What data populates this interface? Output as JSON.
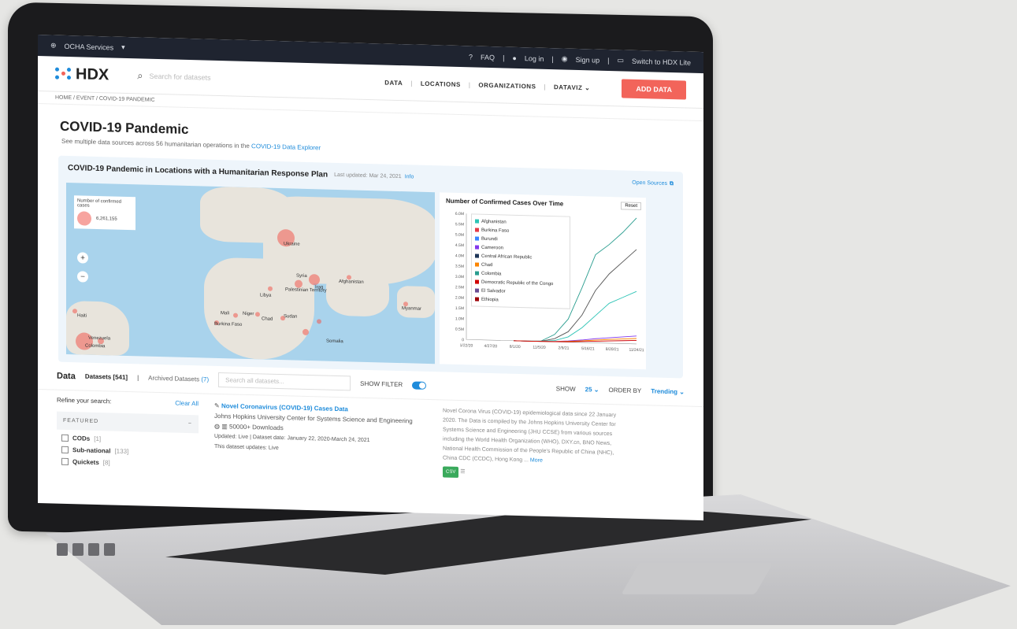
{
  "topbar": {
    "ocha": "OCHA Services",
    "faq": "FAQ",
    "login": "Log in",
    "signup": "Sign up",
    "switch": "Switch to HDX Lite"
  },
  "header": {
    "logo": "HDX",
    "search_placeholder": "Search for datasets",
    "nav": [
      "DATA",
      "LOCATIONS",
      "ORGANIZATIONS",
      "DATAVIZ"
    ],
    "add_data": "ADD DATA"
  },
  "breadcrumb": "HOME / EVENT / COVID-19 PANDEMIC",
  "page": {
    "title": "COVID-19 Pandemic",
    "subtitle": "See multiple data sources across 56 humanitarian operations in the",
    "subtitle_link": "COVID-19 Data Explorer"
  },
  "panel": {
    "title": "COVID-19 Pandemic in Locations with a Humanitarian Response Plan",
    "updated": "Last updated: Mar 24, 2021",
    "info": "Info",
    "source": "Open Sources",
    "map_legend_title": "Number of confirmed cases",
    "map_legend_value": "6,261,155",
    "map_labels": [
      "Ukraine",
      "Afghanistan",
      "Libya",
      "Syria",
      "Palestinian Territory",
      "Iraq",
      "Mali",
      "Niger",
      "Chad",
      "Sudan",
      "Burkina Faso",
      "Myanmar",
      "Haiti",
      "Venezuela",
      "Colombia",
      "Somalia"
    ]
  },
  "chart_data": {
    "type": "line",
    "title": "Number of Confirmed Cases Over Time",
    "reset_label": "Reset",
    "legend": [
      {
        "name": "Afghanistan",
        "color": "#2ec4b6"
      },
      {
        "name": "Burkina Faso",
        "color": "#e63946"
      },
      {
        "name": "Burundi",
        "color": "#3a86ff"
      },
      {
        "name": "Cameroon",
        "color": "#8338ec"
      },
      {
        "name": "Central African Republic",
        "color": "#1d3557"
      },
      {
        "name": "Chad",
        "color": "#fb8500"
      },
      {
        "name": "Colombia",
        "color": "#2a9d8f"
      },
      {
        "name": "Democratic Republic of the Congo",
        "color": "#d00000"
      },
      {
        "name": "El Salvador",
        "color": "#6a4c93"
      },
      {
        "name": "Ethiopia",
        "color": "#9d0208"
      }
    ],
    "x_ticks": [
      "1/22/20",
      "4/27/20",
      "8/1/20",
      "11/5/20",
      "2/9/21",
      "5/16/21",
      "8/20/21",
      "11/24/21"
    ],
    "y_ticks": [
      "0",
      "0.5M",
      "1.0M",
      "1.5M",
      "2.0M",
      "2.5M",
      "3.0M",
      "3.5M",
      "4.0M",
      "4.5M",
      "5.0M",
      "5.5M",
      "6.0M"
    ],
    "ylim": [
      0,
      6000000
    ],
    "series": [
      {
        "color": "#2a9d8f",
        "values": [
          0,
          0,
          20000,
          350000,
          1100000,
          2600000,
          4200000,
          4700000,
          5300000,
          6000000
        ]
      },
      {
        "color": "#555555",
        "values": [
          0,
          0,
          10000,
          150000,
          500000,
          1300000,
          2500000,
          3300000,
          3900000,
          4500000
        ]
      },
      {
        "color": "#2ec4b6",
        "values": [
          0,
          0,
          5000,
          60000,
          250000,
          700000,
          1300000,
          1900000,
          2200000,
          2500000
        ]
      },
      {
        "color": "#8338ec",
        "values": [
          0,
          0,
          1000,
          20000,
          60000,
          120000,
          200000,
          260000,
          320000,
          380000
        ]
      },
      {
        "color": "#fb8500",
        "values": [
          0,
          0,
          500,
          10000,
          40000,
          80000,
          130000,
          180000,
          220000,
          260000
        ]
      },
      {
        "color": "#d00000",
        "values": [
          0,
          0,
          200,
          5000,
          20000,
          50000,
          80000,
          110000,
          140000,
          170000
        ]
      }
    ]
  },
  "datarow": {
    "label": "Data",
    "tab_datasets": "Datasets [541]",
    "tab_archived": "Archived Datasets",
    "archived_count": "(7)",
    "search_placeholder": "Search all datasets...",
    "show_filter": "SHOW FILTER",
    "show": "SHOW",
    "show_value": "25",
    "order_by": "ORDER BY",
    "order_value": "Trending"
  },
  "filters": {
    "refine": "Refine your search:",
    "clear": "Clear All",
    "featured": "FEATURED",
    "items": [
      {
        "label": "CODs",
        "count": "[1]"
      },
      {
        "label": "Sub-national",
        "count": "[133]"
      },
      {
        "label": "Quickets",
        "count": "[8]"
      }
    ]
  },
  "dataset": {
    "title": "Novel Coronavirus (COVID-19) Cases Data",
    "org": "Johns Hopkins University Center for Systems Science and Engineering",
    "downloads": "50000+ Downloads",
    "dates": "Updated: Live | Dataset date: January 22, 2020-March 24, 2021",
    "freq": "This dataset updates: Live"
  },
  "description": {
    "text": "Novel Corona Virus (COVID-19) epidemiological data since 22 January 2020. The Data is compiled by the Johns Hopkins University Center for Systems Science and Engineering (JHU CCSE) from various sources including the World Health Organization (WHO), DXY.cn, BNO News, National Health Commission of the People's Republic of China (NHC), China CDC (CCDC), Hong Kong ...",
    "more": "More",
    "csv": "CSV"
  }
}
